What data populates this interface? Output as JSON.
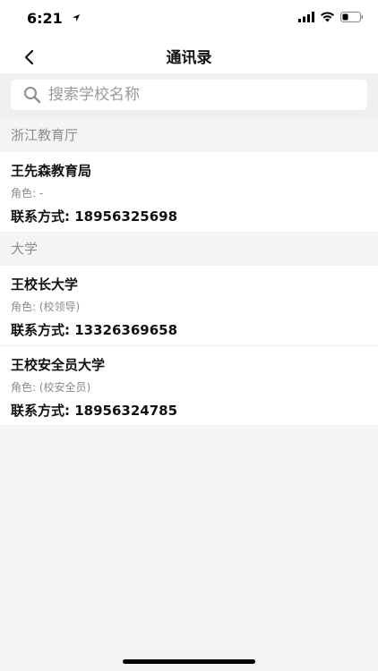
{
  "status_bar": {
    "time": "6:21"
  },
  "nav": {
    "title": "通讯录"
  },
  "search": {
    "placeholder": "搜索学校名称"
  },
  "sections": [
    {
      "title": "浙江教育厅",
      "entries": [
        {
          "name": "王先森教育局",
          "role": "角色: -",
          "contact": "联系方式: 18956325698"
        }
      ]
    },
    {
      "title": "大学",
      "entries": [
        {
          "name": "王校长大学",
          "role": "角色: (校领导)",
          "contact": "联系方式: 13326369658"
        },
        {
          "name": "王校安全员大学",
          "role": "角色: (校安全员)",
          "contact": "联系方式: 18956324785"
        }
      ]
    }
  ]
}
